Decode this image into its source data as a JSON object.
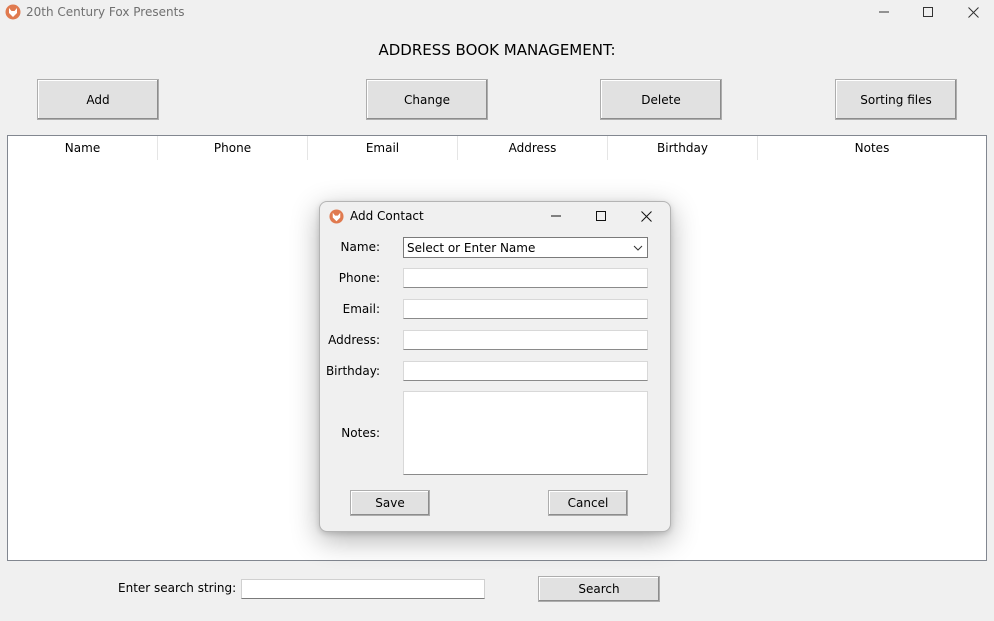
{
  "window": {
    "title": "20th Century Fox Presents",
    "icon": "fox-logo-icon",
    "accent_color": "#e07a4f"
  },
  "header": {
    "title": "ADDRESS BOOK MANAGEMENT:"
  },
  "toolbar": {
    "add_label": "Add",
    "change_label": "Change",
    "delete_label": "Delete",
    "sort_label": "Sorting files"
  },
  "table": {
    "columns": [
      "Name",
      "Phone",
      "Email",
      "Address",
      "Birthday",
      "Notes"
    ],
    "rows": []
  },
  "search": {
    "label": "Enter search string:",
    "value": "",
    "button_label": "Search"
  },
  "dialog": {
    "title": "Add Contact",
    "fields": {
      "name_label": "Name:",
      "name_value": "Select or Enter Name",
      "phone_label": "Phone:",
      "email_label": "Email:",
      "address_label": "Address:",
      "birthday_label": "Birthday:",
      "notes_label": "Notes:"
    },
    "save_label": "Save",
    "cancel_label": "Cancel"
  }
}
